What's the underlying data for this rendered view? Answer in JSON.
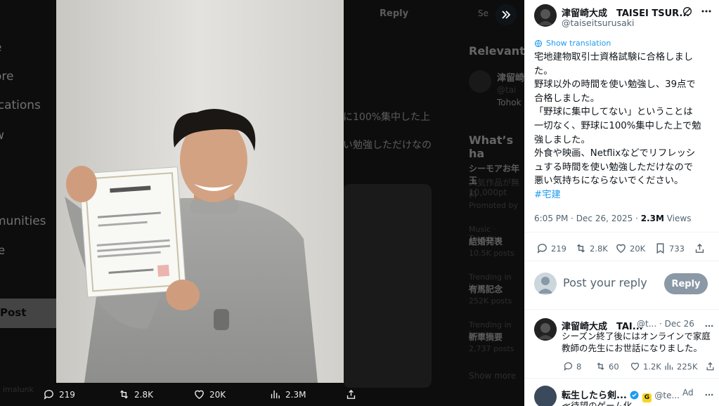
{
  "background": {
    "nav": [
      "e",
      "ore",
      "ications",
      "w",
      "munities",
      "le",
      "."
    ],
    "post_button": "Post",
    "reply_label": "Reply",
    "search": "Se",
    "relevant": "Relevant",
    "relevant_name": "津留崎",
    "relevant_handle": "@tai",
    "relevant_sub": "Tohok",
    "whats_happening": "What’s ha",
    "trend1_title": "シーモアお年玉",
    "trend1_sub": "人気作品が無料",
    "trend1_sub2": "10,000pt",
    "promoted": "Promoted by",
    "trend2_cat": "Music · Trending",
    "trend2_title": "結婚発表",
    "trend2_posts": "10.5K posts",
    "trend3_cat": "Trending in Japan",
    "trend3_title": "有馬記念",
    "trend3_posts": "252K posts",
    "trend4_cat": "Trending in Japan",
    "trend4_title": "新車摘要",
    "trend4_posts": "2,737 posts",
    "show_more": "Show more",
    "tweet_fragment1": "に100%集中した上",
    "tweet_fragment2": "い勉強しただけなの",
    "footer_handle": "imalunk"
  },
  "media_bar": {
    "replies": "219",
    "reposts": "2.8K",
    "likes": "20K",
    "views": "2.3M"
  },
  "panel": {
    "author_name": "津留崎大成　TAISEI TSUR...",
    "author_handle": "@taiseitsurusaki",
    "show_translation": "Show translation",
    "body_lines": [
      "宅地建物取引士資格試験に合格しまし",
      "た。",
      "野球以外の時間を使い勉強し、39点で",
      "合格しました。",
      "「野球に集中してない」ということは",
      "一切なく、野球に100%集中した上で勉",
      "強しました。",
      "外食や映画、Netflixなどでリフレッシ",
      "ュする時間を使い勉強しただけなので",
      "悪い気持ちにならないでください。"
    ],
    "hashtag": "#宅建",
    "time": "6:05 PM · Dec 26, 2025 · ",
    "views_count": "2.3M",
    "views_label": " Views",
    "stats": {
      "replies": "219",
      "reposts": "2.8K",
      "likes": "20K",
      "bookmarks": "733"
    },
    "reply_placeholder": "Post your reply",
    "reply_button": "Reply",
    "reply": {
      "name": "津留崎大成　TAI...",
      "handle_date": "@t... · Dec 26",
      "text": "シーズン終了後にはオンラインで家庭教師の先生にお世話になりました。",
      "replies": "8",
      "reposts": "60",
      "likes": "1.2K",
      "views": "225K"
    },
    "ad": {
      "name": "転生したら剣...",
      "badge_g": "G",
      "handle": "@te...",
      "ad_label": "Ad",
      "text_fragment": "≪待望のゲーム化"
    }
  },
  "colors": {
    "accent": "#1d9bf0",
    "reply_button": "#8b98a5",
    "verified": "#1d9bf0",
    "badge_g": "#f7d51d"
  }
}
